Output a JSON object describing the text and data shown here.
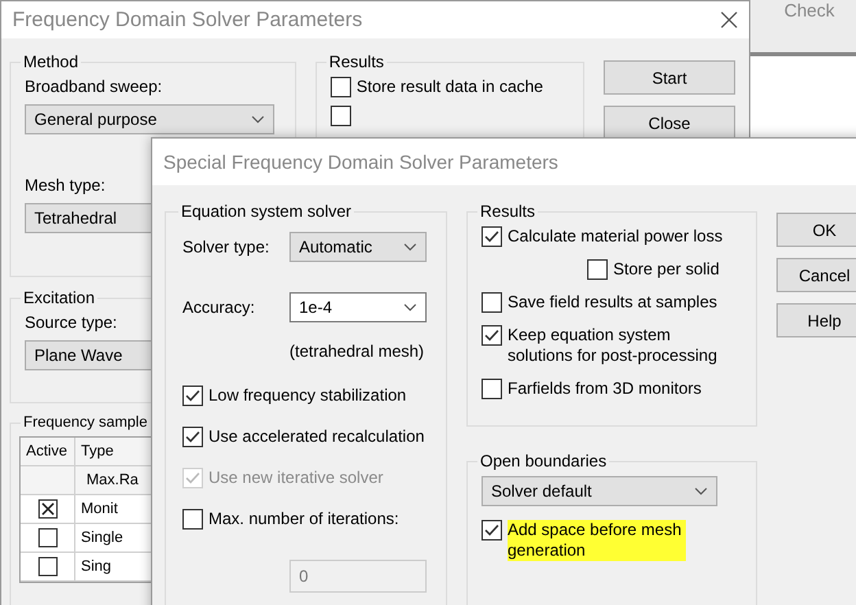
{
  "background_window": {
    "title": "Check"
  },
  "main_window": {
    "title": "Frequency Domain Solver Parameters",
    "method": {
      "title": "Method",
      "broadband_label": "Broadband sweep:",
      "broadband_value": "General purpose",
      "mesh_label": "Mesh type:",
      "mesh_value": "Tetrahedral"
    },
    "results": {
      "title": "Results",
      "options": [
        {
          "label": "Store result data in cache",
          "checked": false
        },
        {
          "checked": false
        }
      ]
    },
    "buttons": [
      "Start",
      "Close"
    ],
    "excitation": {
      "title": "Excitation",
      "source_label": "Source type:",
      "source_value": "Plane Wave"
    },
    "frequency_samples": {
      "title": "Frequency sample",
      "columns": [
        "Active",
        "Type"
      ],
      "rows": [
        {
          "type": "Max.Ra"
        },
        {
          "active": true,
          "type": "Monit"
        },
        {
          "active": false,
          "type": "Single"
        },
        {
          "active": false,
          "type": "Sing"
        }
      ]
    }
  },
  "dialog": {
    "title": "Special Frequency Domain Solver Parameters",
    "equation_solver": {
      "title": "Equation system solver",
      "solver_type_label": "Solver type:",
      "solver_type_value": "Automatic",
      "accuracy_label": "Accuracy:",
      "accuracy_value": "1e-4",
      "accuracy_note": "(tetrahedral mesh)",
      "options": [
        {
          "label": "Low frequency stabilization",
          "checked": true,
          "disabled": false
        },
        {
          "label": "Use accelerated recalculation",
          "checked": true,
          "disabled": false
        },
        {
          "label": "Use new iterative solver",
          "checked": true,
          "disabled": true
        },
        {
          "label": "Max. number of iterations:",
          "checked": false,
          "disabled": false
        }
      ],
      "iterations_value": "0"
    },
    "results": {
      "title": "Results",
      "options": [
        {
          "label": "Calculate material power loss",
          "checked": true,
          "children": [
            {
              "label": "Store per solid",
              "checked": false
            }
          ]
        },
        {
          "label": "Save field results at samples",
          "checked": false
        },
        {
          "label": "Keep equation system solutions for post-processing",
          "checked": true
        },
        {
          "label": "Farfields from 3D monitors",
          "checked": false
        }
      ]
    },
    "open_boundaries": {
      "title": "Open boundaries",
      "value": "Solver default",
      "option": {
        "label": "Add space before mesh generation",
        "checked": true,
        "highlighted": true
      }
    },
    "buttons": [
      "OK",
      "Cancel",
      "Help"
    ]
  }
}
